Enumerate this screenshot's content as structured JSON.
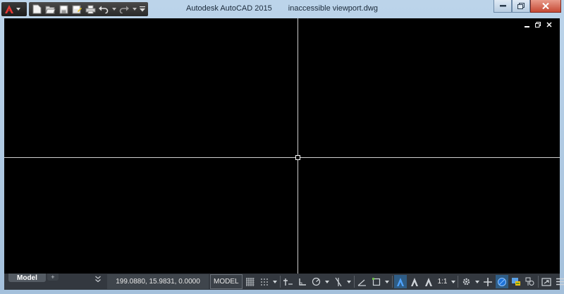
{
  "window": {
    "app_title": "Autodesk AutoCAD 2015",
    "document_title": "inaccessible viewport.dwg"
  },
  "quick_access": {
    "icons": [
      "autocad-logo-icon",
      "new-icon",
      "open-icon",
      "save-icon",
      "save-as-icon",
      "plot-icon",
      "undo-icon",
      "redo-icon",
      "customize-icon"
    ]
  },
  "colors": {
    "canvas": "#000000",
    "crosshair": "#cfcfcf",
    "statusbar": "#33383f",
    "accent": "#2f5d86",
    "logo_red": "#d32f2f"
  },
  "layout_tabs": {
    "model": "Model",
    "add": "+"
  },
  "statusbar": {
    "coordinates": "199.0880, 15.9831, 0.0000",
    "model_label": "MODEL",
    "scale": "1:1",
    "icons": [
      "grid-icon",
      "snap-icon",
      "infer-icon",
      "ortho-icon",
      "polar-icon",
      "isodraft-icon",
      "osnap-icon",
      "selection-cycling-icon",
      "annotation-visibility-icon",
      "autoscale-icon",
      "annotation-scale-icon",
      "workspace-gear-icon",
      "plus-icon",
      "isolate-icon",
      "hardware-accel-icon",
      "clean-screen-icon",
      "customize-menu-icon"
    ]
  }
}
